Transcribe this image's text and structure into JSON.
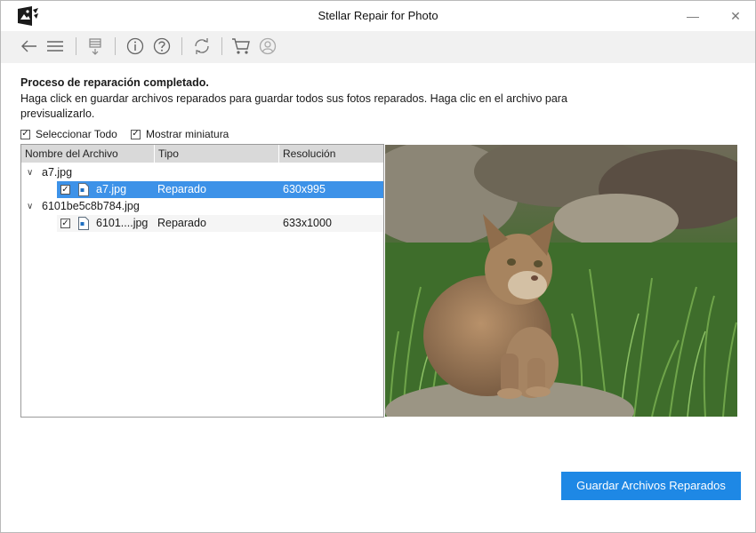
{
  "window": {
    "title": "Stellar Repair for Photo"
  },
  "status": {
    "heading": "Proceso de reparación completado.",
    "description": "Haga click en guardar archivos reparados para guardar todos sus fotos reparados. Haga clic en el archivo para previsualizarlo."
  },
  "options": {
    "select_all": "Seleccionar Todo",
    "show_thumbnails": "Mostrar miniatura"
  },
  "table": {
    "columns": [
      "Nombre del Archivo",
      "Tipo",
      "Resolución"
    ],
    "groups": [
      {
        "name": "a7.jpg",
        "files": [
          {
            "name": "a7.jpg",
            "type": "Reparado",
            "resolution": "630x995",
            "selected": true
          }
        ]
      },
      {
        "name": "6101be5c8b784.jpg",
        "files": [
          {
            "name": "6101....jpg",
            "type": "Reparado",
            "resolution": "633x1000",
            "selected": false
          }
        ]
      }
    ]
  },
  "actions": {
    "save_label": "Guardar Archivos Reparados"
  },
  "colors": {
    "accent": "#1e88e5",
    "selection": "#3d92e8",
    "toolbar_bg": "#f1f1f1"
  },
  "icons": [
    "app-logo-icon",
    "back-arrow-icon",
    "menu-icon",
    "save-report-icon",
    "info-icon",
    "help-icon",
    "refresh-icon",
    "cart-icon",
    "user-icon",
    "minimize-icon",
    "close-icon"
  ]
}
